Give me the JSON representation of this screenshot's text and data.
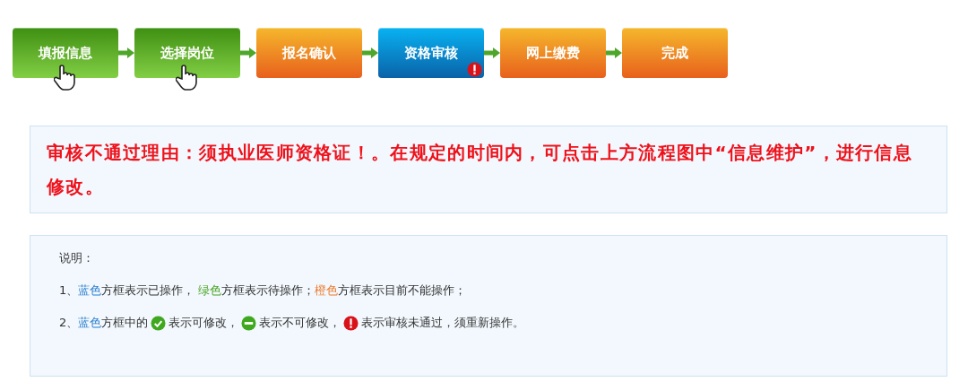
{
  "steps": [
    {
      "label": "填报信息",
      "kind": "pending",
      "cursor": true,
      "error": false
    },
    {
      "label": "选择岗位",
      "kind": "pending",
      "cursor": true,
      "error": false
    },
    {
      "label": "报名确认",
      "kind": "locked",
      "cursor": false,
      "error": false
    },
    {
      "label": "资格审核",
      "kind": "done",
      "cursor": false,
      "error": true
    },
    {
      "label": "网上缴费",
      "kind": "locked",
      "cursor": false,
      "error": false
    },
    {
      "label": "完成",
      "kind": "locked",
      "cursor": false,
      "error": false
    }
  ],
  "reason": "审核不通过理由：须执业医师资格证！。在规定的时间内，可点击上方流程图中“信息维护”，进行信息修改。",
  "legend": {
    "title": "说明：",
    "lines": [
      [
        {
          "kind": "text",
          "segments": [
            {
              "text": "1、"
            },
            {
              "text": "蓝色",
              "color": "#2b7fd0"
            },
            {
              "text": "方框表示已操作， "
            },
            {
              "text": "绿色",
              "color": "#4aa326"
            },
            {
              "text": "方框表示待操作；"
            },
            {
              "text": "橙色",
              "color": "#ee7a2c"
            },
            {
              "text": "方框表示目前不能操作；"
            }
          ]
        }
      ],
      [
        {
          "kind": "text",
          "segments": [
            {
              "text": "2、"
            },
            {
              "text": "蓝色",
              "color": "#2b7fd0"
            },
            {
              "text": "方框中的"
            }
          ]
        },
        {
          "kind": "check"
        },
        {
          "kind": "text",
          "segments": [
            {
              "text": "表示可修改，"
            }
          ]
        },
        {
          "kind": "minus"
        },
        {
          "kind": "text",
          "segments": [
            {
              "text": "表示不可修改，"
            }
          ]
        },
        {
          "kind": "error"
        },
        {
          "kind": "text",
          "segments": [
            {
              "text": "表示审核未通过，须重新操作。"
            }
          ]
        }
      ]
    ]
  }
}
